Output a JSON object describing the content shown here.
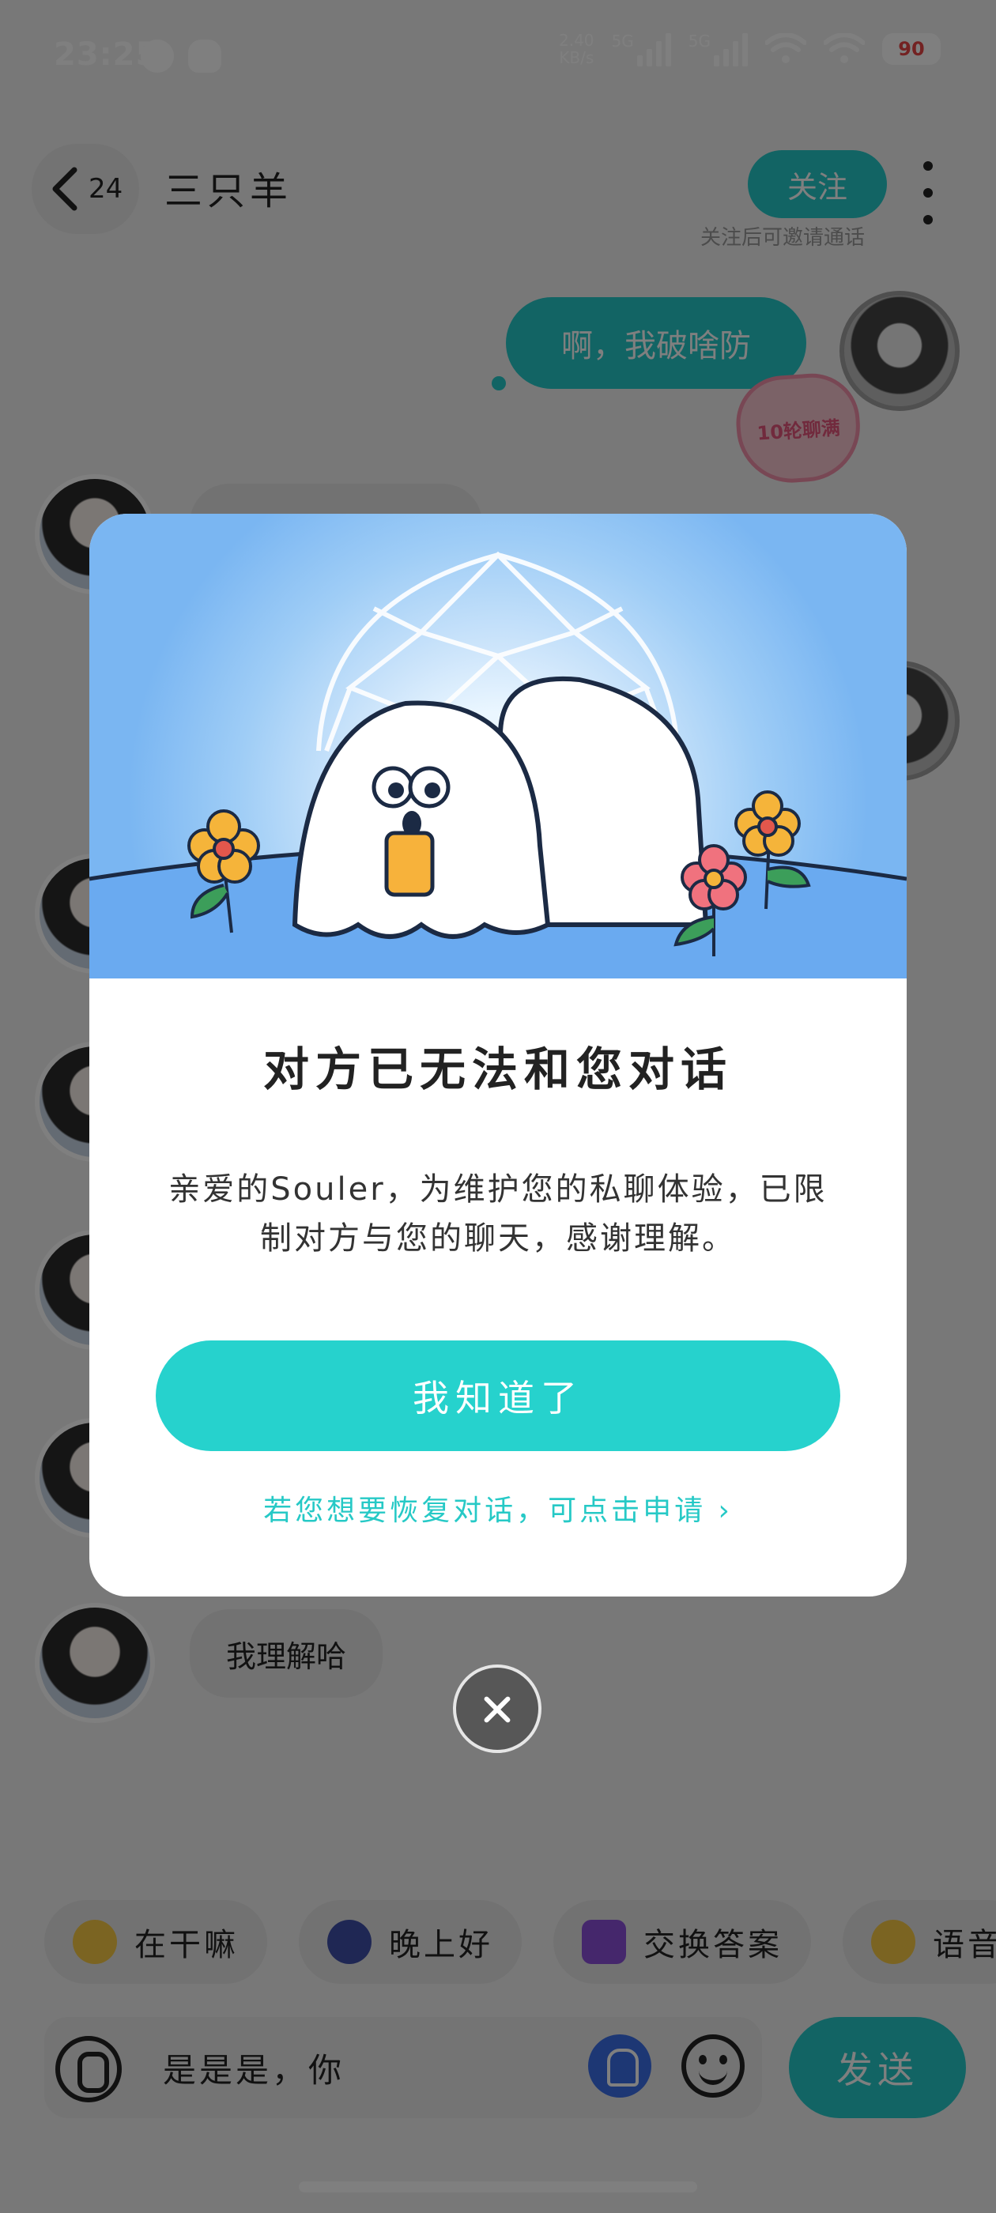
{
  "status_bar": {
    "time": "23:25",
    "net_speed_value": "2.40",
    "net_speed_unit": "KB/s",
    "signal_1_label": "5G",
    "signal_2_label": "5G",
    "battery": "90"
  },
  "header": {
    "back_count": "24",
    "chat_name": "三只羊",
    "follow_label": "关注",
    "follow_hint": "关注后可邀请通话"
  },
  "messages": {
    "outgoing_1": "啊，我破啥防",
    "heart_badge": "10轮聊满",
    "incoming_last": "我理解哈"
  },
  "quick_replies": [
    {
      "label": "在干嘛",
      "icon": "emoji-icon"
    },
    {
      "label": "晚上好",
      "icon": "moon-icon"
    },
    {
      "label": "交换答案",
      "icon": "swap-icon"
    },
    {
      "label": "语音",
      "icon": "emoji-icon"
    }
  ],
  "input": {
    "text": "是是是，你",
    "send_label": "发送"
  },
  "modal": {
    "title": "对方已无法和您对话",
    "description": "亲爱的Souler，为维护您的私聊体验，已限制对方与您的聊天，感谢理解。",
    "confirm_label": "我知道了",
    "appeal_link": "若您想要恢复对话，可点击申请 ›"
  },
  "colors": {
    "accent": "#26d2cd",
    "overlay": "rgba(0,0,0,0.5)"
  }
}
